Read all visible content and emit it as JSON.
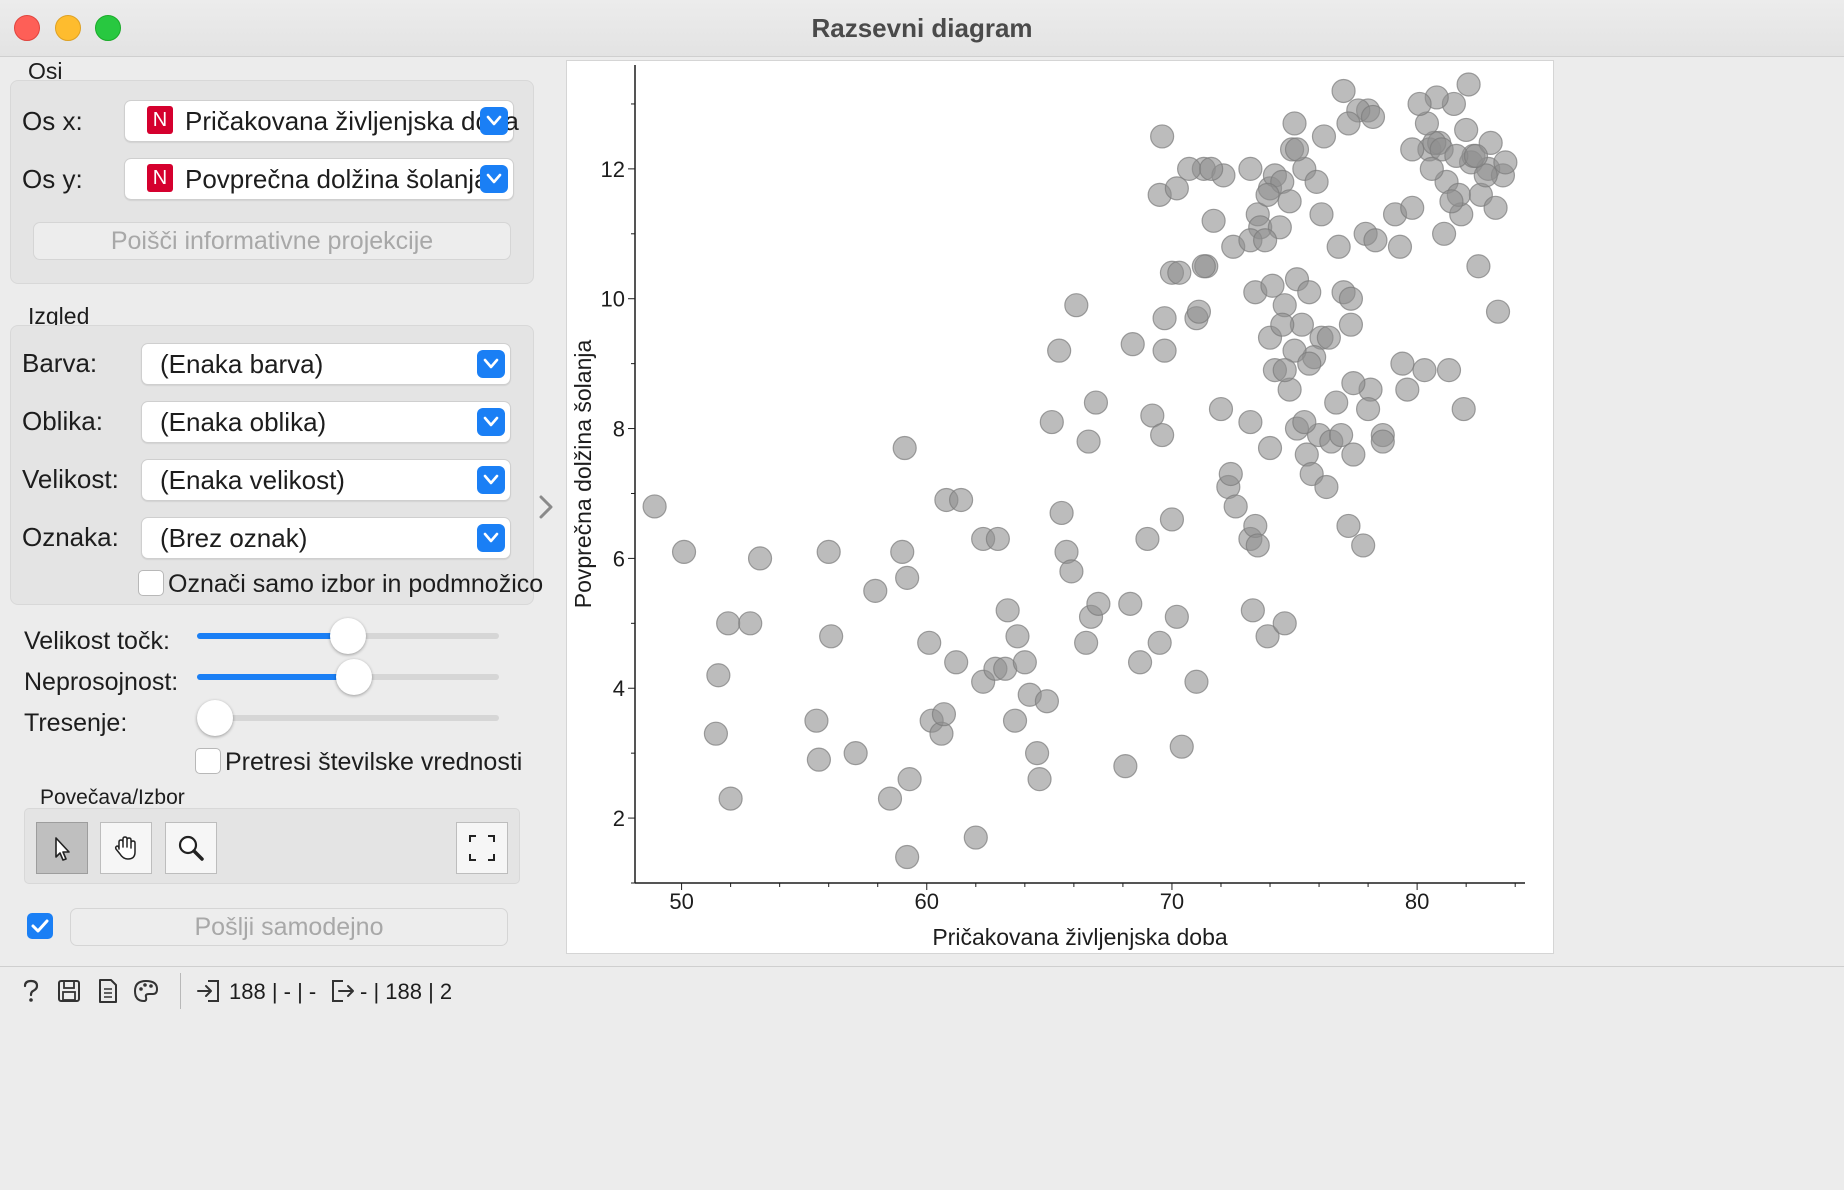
{
  "window": {
    "title": "Razsevni diagram"
  },
  "axes_section": {
    "label": "Osi",
    "x_label": "Os x:",
    "x_badge": "N",
    "x_value": "Pričakovana življenjska doba",
    "y_label": "Os y:",
    "y_badge": "N",
    "y_value": "Povprečna dolžina šolanja",
    "find_button": "Poišči informativne projekcije"
  },
  "appearance_section": {
    "label": "Izgled",
    "color_label": "Barva:",
    "color_value": "(Enaka barva)",
    "shape_label": "Oblika:",
    "shape_value": "(Enaka oblika)",
    "size_label": "Velikost:",
    "size_value": "(Enaka velikost)",
    "label_label": "Oznaka:",
    "label_value": "(Brez oznak)",
    "label_only_selected": "Označi samo izbor in podmnožico",
    "label_only_selected_checked": false
  },
  "sliders": {
    "point_size_label": "Velikost točk:",
    "point_size_fraction": 0.5,
    "opacity_label": "Neprosojnost:",
    "opacity_fraction": 0.52,
    "jitter_label": "Tresenje:",
    "jitter_fraction": 0.0,
    "jitter_numeric": "Pretresi številske vrednosti",
    "jitter_numeric_checked": false
  },
  "zoom_section": {
    "label": "Povečava/Izbor",
    "tools": [
      "pointer-icon",
      "hand-icon",
      "magnifier-icon",
      "fit-icon"
    ],
    "active_tool": "pointer-icon"
  },
  "send": {
    "auto_checked": true,
    "button": "Pošlji samodejno"
  },
  "status": {
    "input_summary": "188 | - | -",
    "output_summary": "- | 188 | 2"
  },
  "chart_data": {
    "type": "scatter",
    "xlabel": "Pričakovana življenjska doba",
    "ylabel": "Povprečna dolžina šolanja",
    "xlim": [
      48.1,
      84.4
    ],
    "ylim": [
      1.0,
      13.6
    ],
    "xticks": [
      50,
      60,
      70,
      80
    ],
    "yticks": [
      2,
      4,
      6,
      8,
      10,
      12
    ],
    "grid": false,
    "point_color": "#909090",
    "x": [
      48.9,
      50.1,
      51.5,
      51.4,
      51.9,
      52.0,
      52.8,
      53.2,
      55.5,
      55.6,
      56.0,
      56.1,
      57.1,
      57.9,
      58.5,
      59.0,
      59.1,
      59.2,
      59.2,
      59.3,
      60.1,
      60.2,
      60.6,
      60.7,
      60.8,
      61.2,
      61.4,
      62.0,
      62.3,
      62.3,
      62.8,
      62.9,
      63.2,
      63.3,
      63.6,
      63.7,
      64.0,
      64.2,
      64.5,
      64.6,
      64.9,
      65.1,
      65.4,
      65.5,
      65.7,
      65.9,
      66.1,
      66.5,
      66.6,
      66.7,
      66.9,
      67.0,
      68.1,
      68.3,
      68.4,
      68.7,
      69.0,
      69.2,
      69.5,
      69.6,
      69.7,
      70.0,
      70.0,
      70.2,
      70.4,
      71.0,
      71.4,
      71.3,
      72.0,
      72.1,
      72.3,
      72.4,
      72.6,
      73.2,
      73.2,
      73.3,
      73.4,
      73.5,
      73.9,
      74.0,
      74.6,
      74.9,
      75.0,
      75.5,
      75.7,
      76.0,
      76.3,
      77.2,
      77.4,
      77.8,
      78.1,
      78.6,
      79.4,
      79.6,
      80.3,
      80.5,
      80.9,
      81.2,
      81.3,
      81.8,
      82.2,
      82.6,
      82.9,
      83.5,
      83.6,
      69.5,
      69.6,
      69.7,
      70.3,
      70.2,
      70.7,
      71.0,
      71.1,
      71.3,
      71.6,
      71.7,
      72.5,
      73.2,
      73.5,
      73.6,
      74.0,
      74.2,
      74.8,
      75.1,
      75.6,
      76.1,
      76.7,
      77.3,
      77.0,
      75.8,
      75.3,
      75.0,
      74.6,
      74.4,
      74.0,
      73.2,
      73.8,
      74.2,
      74.5,
      75.4,
      76.1,
      76.8,
      77.3,
      77.9,
      78.3,
      79.1,
      79.8,
      80.7,
      81.0,
      81.5,
      81.7,
      82.0,
      82.3,
      82.5,
      83.0,
      83.3,
      79.8,
      80.4,
      80.8,
      81.4,
      81.6,
      82.1,
      82.8,
      83.2,
      76.2,
      77.0,
      78.0,
      79.3,
      80.1,
      80.6,
      81.1,
      81.9,
      82.4,
      77.6,
      78.2,
      74.6,
      75.1,
      75.6,
      73.4,
      73.9,
      74.5,
      75.1,
      75.9,
      76.4,
      77.2,
      74.1,
      74.8,
      75.4,
      76.5,
      76.9,
      78.6,
      77.4,
      78.0
    ],
    "y": [
      6.8,
      6.1,
      4.2,
      3.3,
      5.0,
      2.3,
      5.0,
      6.0,
      3.5,
      2.9,
      6.1,
      4.8,
      3.0,
      5.5,
      2.3,
      6.1,
      7.7,
      5.7,
      1.4,
      2.6,
      4.7,
      3.5,
      3.3,
      3.6,
      6.9,
      4.4,
      6.9,
      1.7,
      4.1,
      6.3,
      4.3,
      6.3,
      4.3,
      5.2,
      3.5,
      4.8,
      4.4,
      3.9,
      3.0,
      2.6,
      3.8,
      8.1,
      9.2,
      6.7,
      6.1,
      5.8,
      9.9,
      4.7,
      7.8,
      5.1,
      8.4,
      5.3,
      2.8,
      5.3,
      9.3,
      4.4,
      6.3,
      8.2,
      4.7,
      7.9,
      9.7,
      6.6,
      10.4,
      5.1,
      3.1,
      4.1,
      10.5,
      12.0,
      8.3,
      11.9,
      7.1,
      7.3,
      6.8,
      6.3,
      8.1,
      5.2,
      6.5,
      6.2,
      4.8,
      7.7,
      5.0,
      12.3,
      12.7,
      7.6,
      7.3,
      7.9,
      7.1,
      6.5,
      7.6,
      6.2,
      8.6,
      7.9,
      9.0,
      8.6,
      8.9,
      12.3,
      12.4,
      11.8,
      8.9,
      11.3,
      12.1,
      11.6,
      12.0,
      11.9,
      12.1,
      11.6,
      12.5,
      9.2,
      10.4,
      11.7,
      12.0,
      9.7,
      9.8,
      10.5,
      12.0,
      11.2,
      10.8,
      12.0,
      11.3,
      11.1,
      9.4,
      8.9,
      8.6,
      10.3,
      10.1,
      9.4,
      8.4,
      9.6,
      10.1,
      9.1,
      9.6,
      9.2,
      9.9,
      11.1,
      11.7,
      10.9,
      10.9,
      11.9,
      11.8,
      12.0,
      11.3,
      10.8,
      10.0,
      11.0,
      10.9,
      11.3,
      11.4,
      12.4,
      12.3,
      13.0,
      11.6,
      12.6,
      12.2,
      10.5,
      12.4,
      9.8,
      12.3,
      12.7,
      13.1,
      11.5,
      12.2,
      13.3,
      11.9,
      11.4,
      12.5,
      13.2,
      12.9,
      10.8,
      13.0,
      12.0,
      11.0,
      8.3,
      12.2,
      12.9,
      12.8,
      8.9,
      8.0,
      9.0,
      10.1,
      11.6,
      9.6,
      12.3,
      11.8,
      9.4,
      12.7,
      10.2,
      11.5,
      8.1,
      7.8,
      7.9,
      7.8,
      8.7,
      8.3,
      9.3,
      9.0,
      8.8,
      9.5,
      9.9,
      9.6,
      7.6
    ]
  }
}
